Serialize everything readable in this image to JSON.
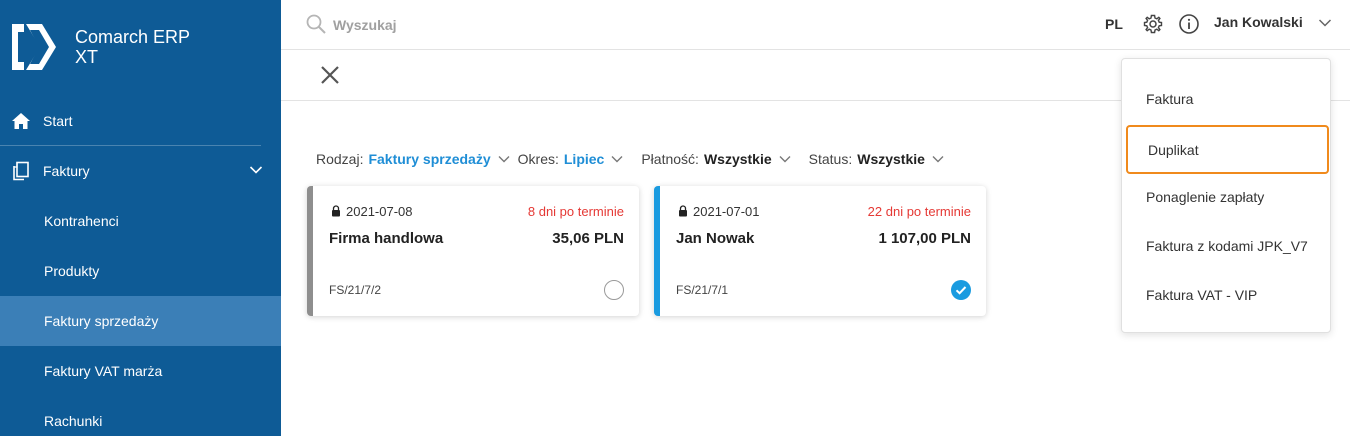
{
  "app": {
    "name_line1": "Comarch ERP",
    "name_line2": "XT"
  },
  "sidebar": {
    "items": [
      {
        "label": "Start",
        "icon": "home-icon"
      },
      {
        "label": "Faktury",
        "icon": "documents-icon"
      },
      {
        "label": "Kontrahenci"
      },
      {
        "label": "Produkty"
      },
      {
        "label": "Faktury sprzedaży",
        "active": true
      },
      {
        "label": "Faktury VAT marża"
      },
      {
        "label": "Rachunki"
      }
    ]
  },
  "topbar": {
    "search_placeholder": "Wyszukaj",
    "lang": "PL",
    "user": "Jan Kowalski"
  },
  "filters": [
    {
      "label": "Rodzaj:",
      "value": "Faktury sprzedaży"
    },
    {
      "label": "Okres:",
      "value": "Lipiec"
    },
    {
      "label": "Płatność:",
      "value": "Wszystkie"
    },
    {
      "label": "Status:",
      "value": "Wszystkie"
    }
  ],
  "cards": [
    {
      "date": "2021-07-08",
      "overdue": "8 dni po terminie",
      "client": "Firma handlowa",
      "amount": "35,06 PLN",
      "doc": "FS/21/7/2",
      "selected": false
    },
    {
      "date": "2021-07-01",
      "overdue": "22 dni po terminie",
      "client": "Jan Nowak",
      "amount": "1 107,00 PLN",
      "doc": "FS/21/7/1",
      "selected": true
    }
  ],
  "menu": {
    "items": [
      "Faktura",
      "Duplikat",
      "Ponaglenie zapłaty",
      "Faktura z kodami JPK_V7",
      "Faktura VAT - VIP"
    ],
    "focused_index": 1
  },
  "colors": {
    "sidebar": "#0e5b96",
    "sidebar_active": "#3b7fb7",
    "accent_blue": "#1a9be0",
    "overdue_red": "#e53935",
    "focus_orange": "#f08a1c"
  }
}
